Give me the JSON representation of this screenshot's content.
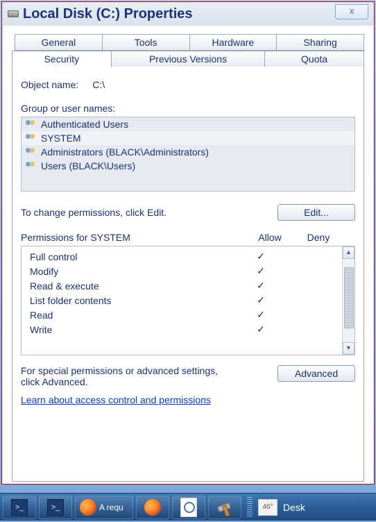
{
  "window": {
    "title": "Local Disk (C:) Properties",
    "close_glyph": "x"
  },
  "tabs_row1": [
    {
      "label": "General"
    },
    {
      "label": "Tools"
    },
    {
      "label": "Hardware"
    },
    {
      "label": "Sharing"
    }
  ],
  "tabs_row2": [
    {
      "label": "Security",
      "active": true
    },
    {
      "label": "Previous Versions"
    },
    {
      "label": "Quota"
    }
  ],
  "security": {
    "object_name_label": "Object name:",
    "object_name_value": "C:\\",
    "group_label": "Group or user names:",
    "users": [
      "Authenticated Users",
      "SYSTEM",
      "Administrators (BLACK\\Administrators)",
      "Users (BLACK\\Users)"
    ],
    "selected_user": "SYSTEM",
    "edit_hint": "To change permissions, click Edit.",
    "edit_button": "Edit...",
    "perm_title": "Permissions for SYSTEM",
    "col_allow": "Allow",
    "col_deny": "Deny",
    "permissions": [
      {
        "name": "Full control",
        "allow": true,
        "deny": false
      },
      {
        "name": "Modify",
        "allow": true,
        "deny": false
      },
      {
        "name": "Read & execute",
        "allow": true,
        "deny": false
      },
      {
        "name": "List folder contents",
        "allow": true,
        "deny": false
      },
      {
        "name": "Read",
        "allow": true,
        "deny": false
      },
      {
        "name": "Write",
        "allow": true,
        "deny": false
      }
    ],
    "advanced_hint": "For special permissions or advanced settings, click Advanced.",
    "advanced_button": "Advanced",
    "help_link": "Learn about access control and permissions"
  },
  "taskbar": {
    "firefox_tab_label": "A requ",
    "temperature": "46°",
    "desk_label": "Desk"
  }
}
